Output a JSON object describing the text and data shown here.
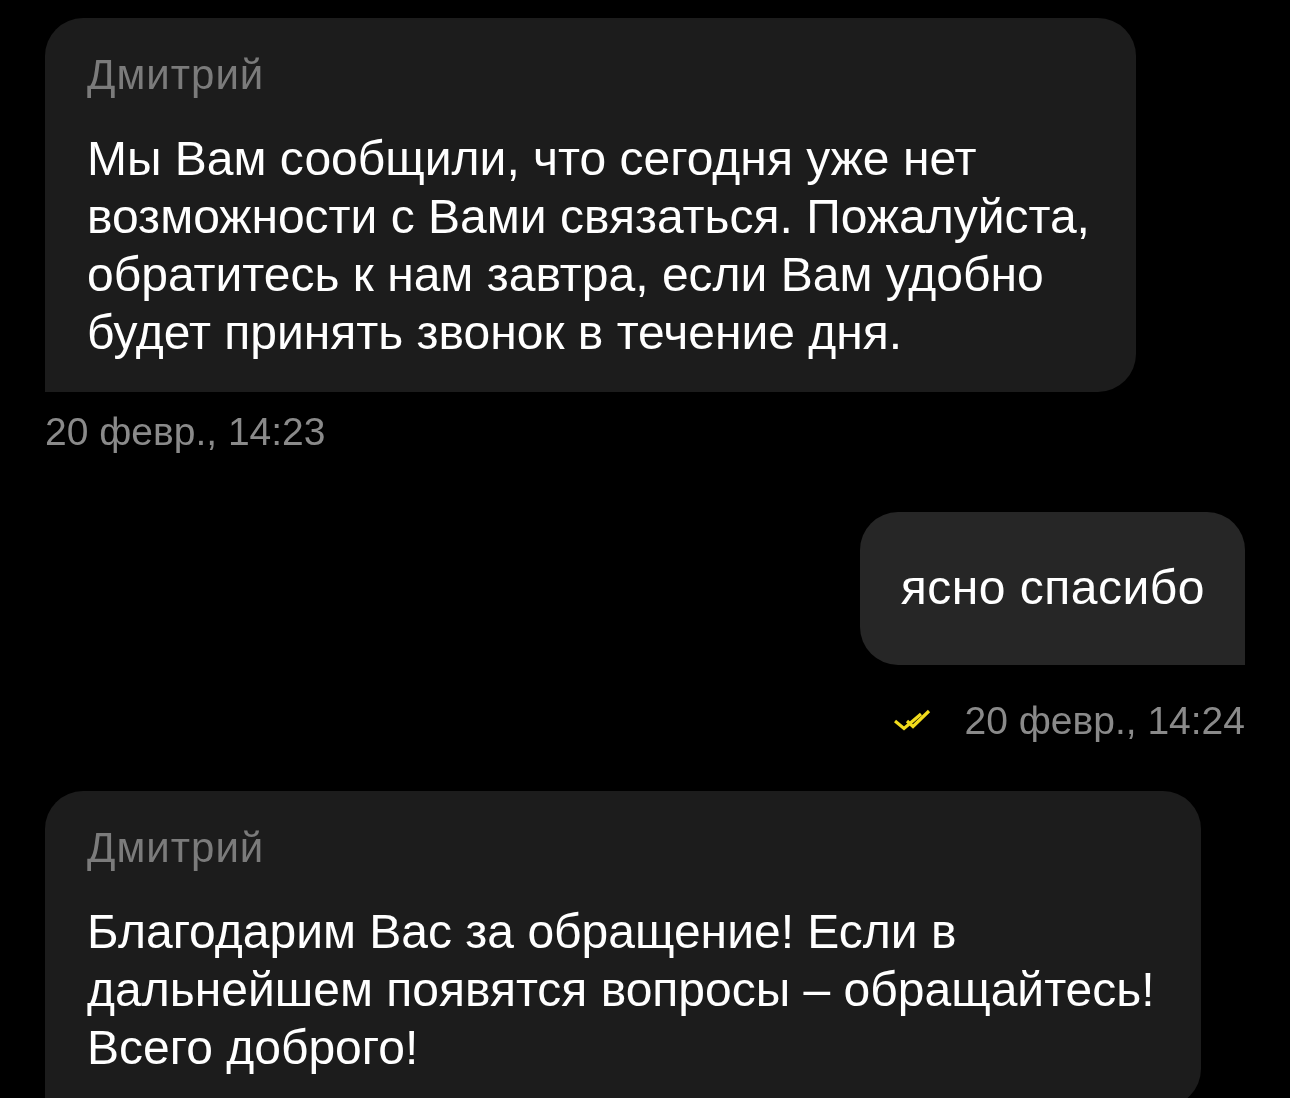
{
  "messages": [
    {
      "kind": "incoming",
      "sender": "Дмитрий",
      "text": "Мы Вам сообщили, что сегодня уже нет\nвозможности с Вами связаться. Пожалуйста,\nобратитесь к нам завтра, если Вам удобно\nбудет принять звонок в течение дня.",
      "time": "20 февр., 14:23"
    },
    {
      "kind": "outgoing",
      "text": "ясно спасибо",
      "read": true,
      "time": "20 февр., 14:24"
    },
    {
      "kind": "incoming",
      "sender": "Дмитрий",
      "text": "Благодарим Вас за обращение! Если в\nдальнейшем появятся вопросы – обращайтесь!\nВсего доброго!"
    }
  ]
}
